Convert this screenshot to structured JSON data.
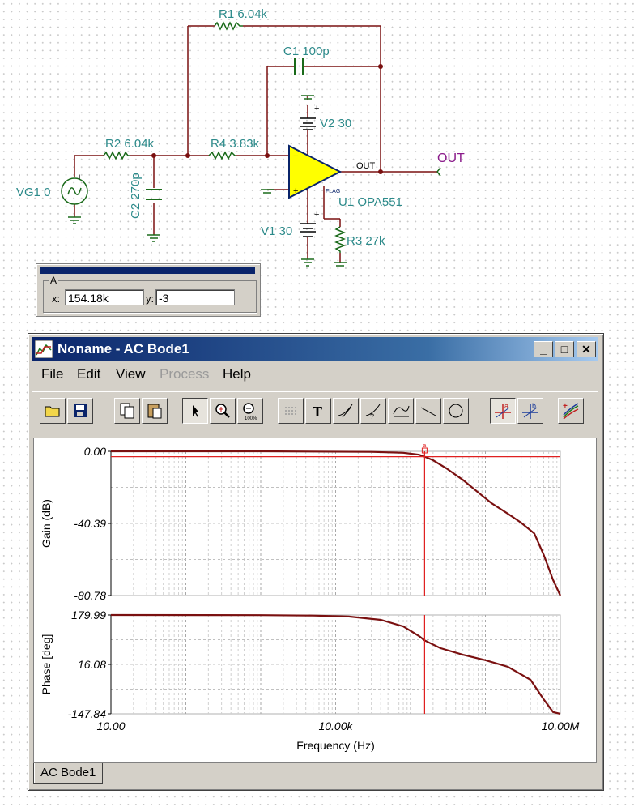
{
  "schematic": {
    "r1": "R1 6.04k",
    "c1": "C1 100p",
    "r2": "R2 6.04k",
    "r4": "R4 3.83k",
    "c2": "C2 270p",
    "vg1": "VG1 0",
    "v2": "V2 30",
    "v1": "V1 30",
    "u1": "U1 OPA551",
    "r3": "R3 27k",
    "out_pin": "OUT",
    "flag_pin": "FLAG",
    "out_port": "OUT"
  },
  "cursor_box": {
    "group": "A",
    "x_label": "x:",
    "x_value": "154.18k",
    "y_label": "y:",
    "y_value": "-3"
  },
  "window": {
    "title": "Noname - AC Bode1",
    "minimize": "_",
    "maximize": "□",
    "close": "✕"
  },
  "menu": {
    "file": "File",
    "edit": "Edit",
    "view": "View",
    "process": "Process",
    "help": "Help"
  },
  "toolbar": {
    "icons": [
      "open-icon",
      "save-icon",
      "copy-icon",
      "paste-icon",
      "select-arrow-icon",
      "zoom-in-icon",
      "zoom-100-icon",
      "grid-icon",
      "text-icon",
      "tangent-icon",
      "slope-icon",
      "curve-fit-icon",
      "line-icon",
      "circle-icon",
      "cursor-a-icon",
      "cursor-b-icon",
      "multi-curve-icon"
    ]
  },
  "tabs": {
    "active": "AC Bode1"
  },
  "chart_data": [
    {
      "type": "line",
      "title": "",
      "xlabel": "Frequency (Hz)",
      "ylabel": "Gain (dB)",
      "x_scale": "log",
      "xlim": [
        10,
        10000000
      ],
      "ylim": [
        -80.78,
        0
      ],
      "y_ticks": [
        "0.00",
        "-40.39",
        "-80.78"
      ],
      "grid": true,
      "series": [
        {
          "color": "#7a1010",
          "points": [
            [
              10,
              0
            ],
            [
              1000,
              0
            ],
            [
              30000,
              -0.3
            ],
            [
              80000,
              -0.8
            ],
            [
              130000,
              -1.9
            ],
            [
              154180,
              -3
            ],
            [
              200000,
              -5
            ],
            [
              300000,
              -9.5
            ],
            [
              500000,
              -16
            ],
            [
              800000,
              -23
            ],
            [
              1200000,
              -29
            ],
            [
              2000000,
              -35
            ],
            [
              3000000,
              -40
            ],
            [
              4500000,
              -46
            ],
            [
              6000000,
              -58
            ],
            [
              8000000,
              -72
            ],
            [
              10000000,
              -80.78
            ]
          ]
        }
      ],
      "cursor": {
        "label": "a",
        "x": 154180,
        "y": -3,
        "color": "#e02020"
      }
    },
    {
      "type": "line",
      "xlabel": "Frequency (Hz)",
      "ylabel": "Phase [deg]",
      "x_scale": "log",
      "xlim": [
        10,
        10000000
      ],
      "ylim": [
        -147.84,
        179.99
      ],
      "y_ticks": [
        "179.99",
        "16.08",
        "-147.84"
      ],
      "x_ticks": [
        "10.00",
        "10.00k",
        "10.00M"
      ],
      "grid": true,
      "series": [
        {
          "color": "#7a1010",
          "points": [
            [
              10,
              179.99
            ],
            [
              1000,
              179.5
            ],
            [
              5000,
              178
            ],
            [
              15000,
              175
            ],
            [
              40000,
              164
            ],
            [
              80000,
              142
            ],
            [
              130000,
              110
            ],
            [
              154180,
              96
            ],
            [
              250000,
              70
            ],
            [
              500000,
              48
            ],
            [
              1000000,
              30
            ],
            [
              2000000,
              8
            ],
            [
              4000000,
              -35
            ],
            [
              6000000,
              -100
            ],
            [
              8000000,
              -142
            ],
            [
              10000000,
              -147.84
            ]
          ]
        }
      ]
    }
  ]
}
